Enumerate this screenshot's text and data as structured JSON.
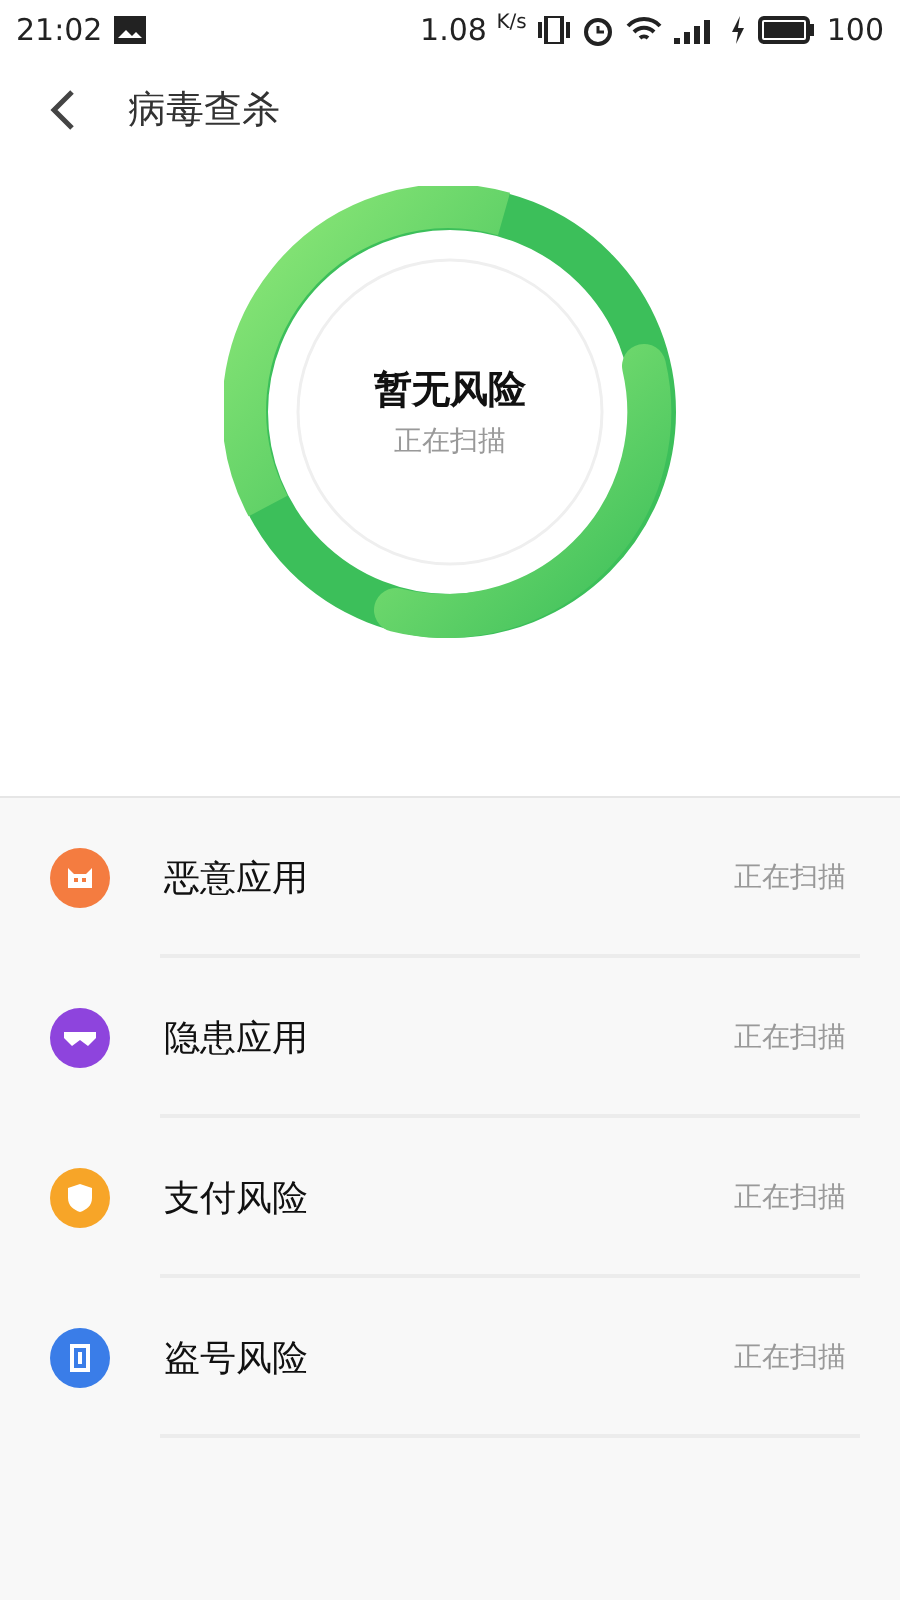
{
  "status_bar": {
    "time": "21:02",
    "speed": "1.08",
    "speed_unit": "K/s",
    "battery": "100"
  },
  "header": {
    "title": "病毒查杀"
  },
  "scan": {
    "result": "暂无风险",
    "status": "正在扫描"
  },
  "items": [
    {
      "label": "恶意应用",
      "status": "正在扫描",
      "color": "#f47c40",
      "kind": "bot"
    },
    {
      "label": "隐患应用",
      "status": "正在扫描",
      "color": "#8e44dd",
      "kind": "mask"
    },
    {
      "label": "支付风险",
      "status": "正在扫描",
      "color": "#f7a528",
      "kind": "shield"
    },
    {
      "label": "盗号风险",
      "status": "正在扫描",
      "color": "#3a7de8",
      "kind": "phone"
    }
  ]
}
